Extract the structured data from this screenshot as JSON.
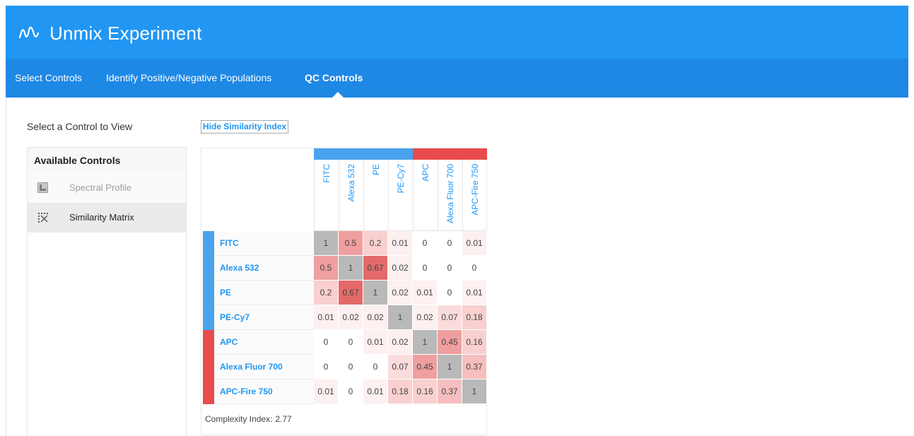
{
  "app": {
    "title": "Unmix Experiment",
    "logo_icon": "wave-logo-icon"
  },
  "tabs": [
    {
      "label": "Select Controls",
      "active": false
    },
    {
      "label": "Identify Positive/Negative Populations",
      "active": false
    },
    {
      "label": "QC Controls",
      "active": true
    }
  ],
  "sidebar": {
    "prompt": "Select a Control to View",
    "header": "Available Controls",
    "items": [
      {
        "label": "Spectral Profile",
        "icon": "spectral-profile-icon",
        "selected": false
      },
      {
        "label": "Similarity Matrix",
        "icon": "similarity-matrix-icon",
        "selected": true
      }
    ]
  },
  "matrix": {
    "toggle_label": "Hide Similarity Index",
    "colors": {
      "blue": "#4aa3ee",
      "red": "#e84c4c"
    },
    "labels": [
      "FITC",
      "Alexa 532",
      "PE",
      "PE-Cy7",
      "APC",
      "Alexa Fluor 700",
      "APC-Fire 750"
    ],
    "groups": [
      "blue",
      "blue",
      "blue",
      "blue",
      "red",
      "red",
      "red"
    ],
    "values": [
      [
        "1",
        "0.5",
        "0.2",
        "0.01",
        "0",
        "0",
        "0.01"
      ],
      [
        "0.5",
        "1",
        "0.67",
        "0.02",
        "0",
        "0",
        "0"
      ],
      [
        "0.2",
        "0.67",
        "1",
        "0.02",
        "0.01",
        "0",
        "0.01"
      ],
      [
        "0.01",
        "0.02",
        "0.02",
        "1",
        "0.02",
        "0.07",
        "0.18"
      ],
      [
        "0",
        "0",
        "0.01",
        "0.02",
        "1",
        "0.45",
        "0.16"
      ],
      [
        "0",
        "0",
        "0",
        "0.07",
        "0.45",
        "1",
        "0.37"
      ],
      [
        "0.01",
        "0",
        "0.01",
        "0.18",
        "0.16",
        "0.37",
        "1"
      ]
    ],
    "complexity_label": "Complexity Index:",
    "complexity_value": "2.77"
  }
}
